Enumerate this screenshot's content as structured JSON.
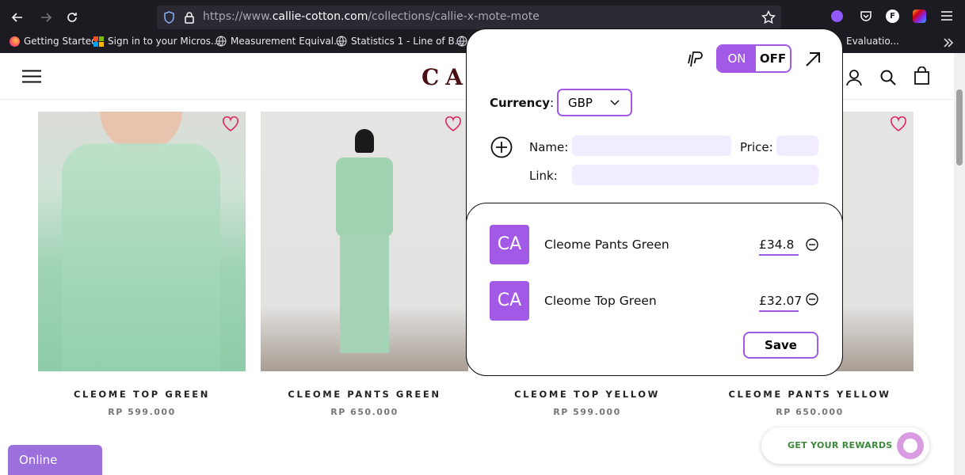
{
  "browser": {
    "url_prefix": "https://www.",
    "url_domain": "callie-cotton.com",
    "url_path": "/collections/callie-x-mote-mote",
    "profile_initial": "F",
    "bookmarks": [
      "Getting Started",
      "Sign in to your Micros...",
      "Measurement Equival...",
      "Statistics 1 - Line of B...",
      "Evaluatio..."
    ]
  },
  "site": {
    "logo": "CA"
  },
  "products": [
    {
      "name": "CLEOME TOP GREEN",
      "price": "RP 599.000"
    },
    {
      "name": "CLEOME PANTS GREEN",
      "price": "RP 650.000"
    },
    {
      "name": "CLEOME TOP YELLOW",
      "price": "RP 599.000"
    },
    {
      "name": "CLEOME PANTS YELLOW",
      "price": "RP 650.000"
    }
  ],
  "popup": {
    "toggle_on": "ON",
    "toggle_off": "OFF",
    "currency_label": "Currency",
    "currency_colon": ":",
    "currency_value": "GBP",
    "name_label": "Name:",
    "price_label": "Price:",
    "link_label": "Link:",
    "items": [
      {
        "avatar": "CA",
        "name": "Cleome Pants Green",
        "price": "£34.8"
      },
      {
        "avatar": "CA",
        "name": "Cleome Top Green",
        "price": "£32.07"
      }
    ],
    "save_label": "Save",
    "accent_color": "#a259e6"
  },
  "widgets": {
    "online": "Online",
    "rewards": "GET YOUR REWARDS"
  }
}
